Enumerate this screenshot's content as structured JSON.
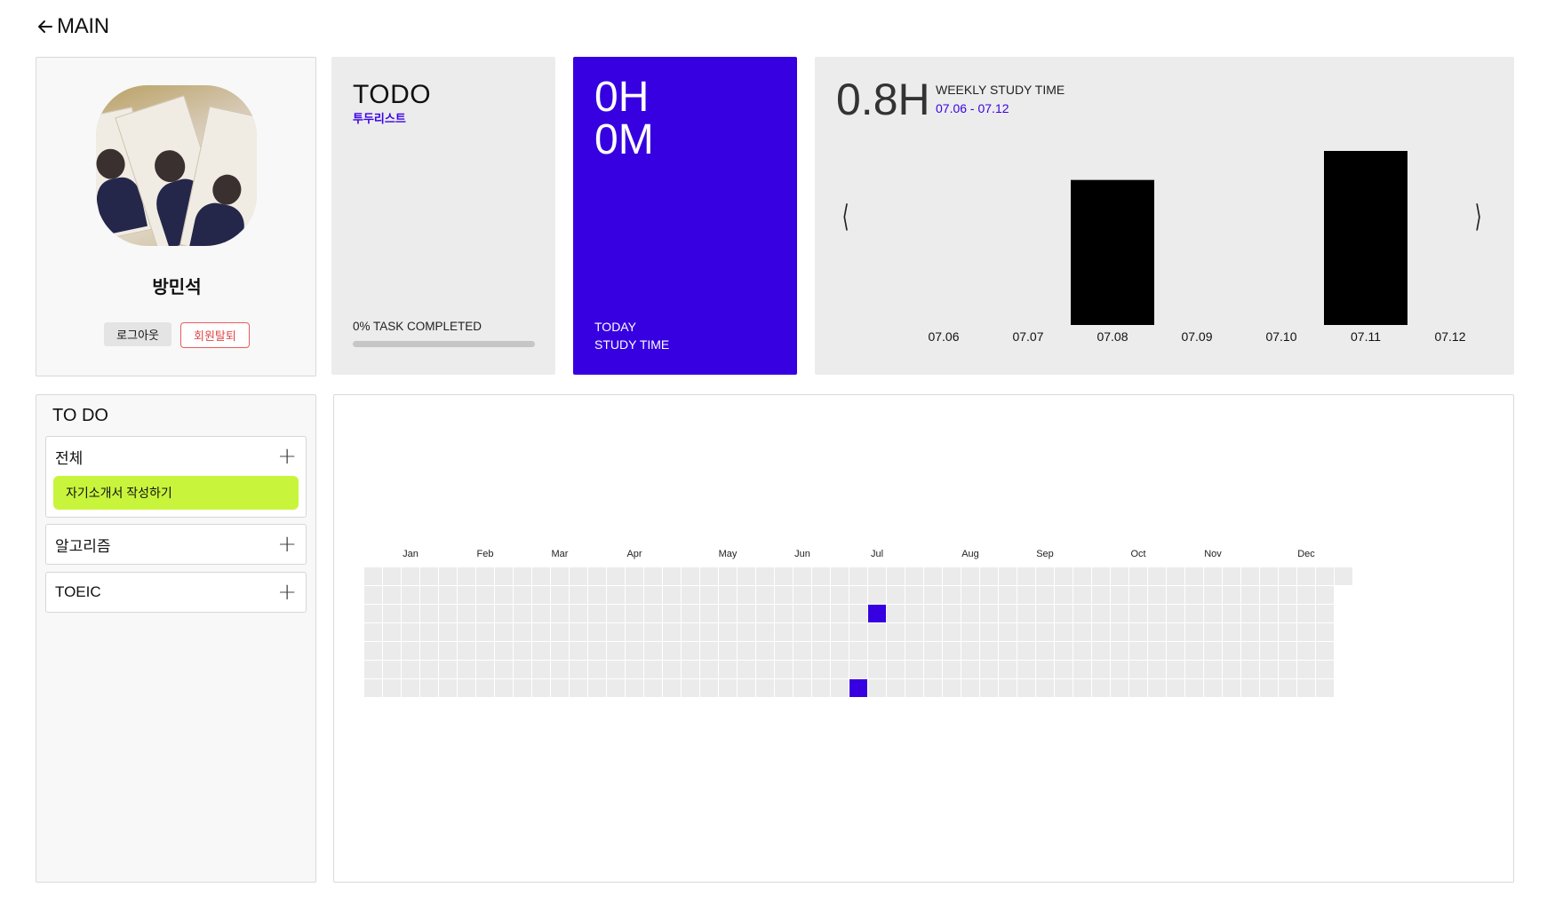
{
  "header": {
    "back_label": "MAIN"
  },
  "profile": {
    "name": "방민석",
    "logout_label": "로그아웃",
    "withdraw_label": "회원탈퇴"
  },
  "todo_summary": {
    "title": "TODO",
    "subtitle": "투두리스트",
    "completed_text": "0% TASK COMPLETED",
    "completed_percent": 0
  },
  "today": {
    "hours": "0H",
    "minutes": "0M",
    "label_line1": "TODAY",
    "label_line2": "STUDY TIME"
  },
  "weekly": {
    "total": "0.8H",
    "title": "WEEKLY STUDY TIME",
    "range": "07.06 - 07.12",
    "prev_icon": "chevron-left-icon",
    "next_icon": "chevron-right-icon"
  },
  "todo_list": {
    "title": "TO DO",
    "categories": [
      {
        "label": "전체",
        "items": [
          "자기소개서 작성하기"
        ]
      },
      {
        "label": "알고리즘",
        "items": []
      },
      {
        "label": "TOEIC",
        "items": []
      }
    ]
  },
  "colors": {
    "accent": "#3700e0",
    "todo_item": "#c8f53c",
    "withdraw_red": "#e04848",
    "heat_empty": "#ebebeb",
    "bar": "#000000"
  },
  "chart_data": [
    {
      "type": "bar",
      "categories": [
        "07.06",
        "07.07",
        "07.08",
        "07.09",
        "07.10",
        "07.11",
        "07.12"
      ],
      "values": [
        0,
        0,
        0.35,
        0,
        0,
        0.42,
        0
      ],
      "ylim": [
        0,
        0.45
      ],
      "grid": false
    },
    {
      "type": "heatmap",
      "month_labels": [
        "Jan",
        "Feb",
        "Mar",
        "Apr",
        "May",
        "Jun",
        "Jul",
        "Aug",
        "Sep",
        "Oct",
        "Nov",
        "Dec"
      ],
      "month_start_weeks": [
        2,
        6,
        10,
        14,
        19,
        23,
        27,
        32,
        36,
        41,
        45,
        50
      ],
      "weeks": 53,
      "days_per_week": 7,
      "active_cells": [
        {
          "week": 27,
          "day": 2
        },
        {
          "week": 26,
          "day": 6
        }
      ]
    }
  ]
}
